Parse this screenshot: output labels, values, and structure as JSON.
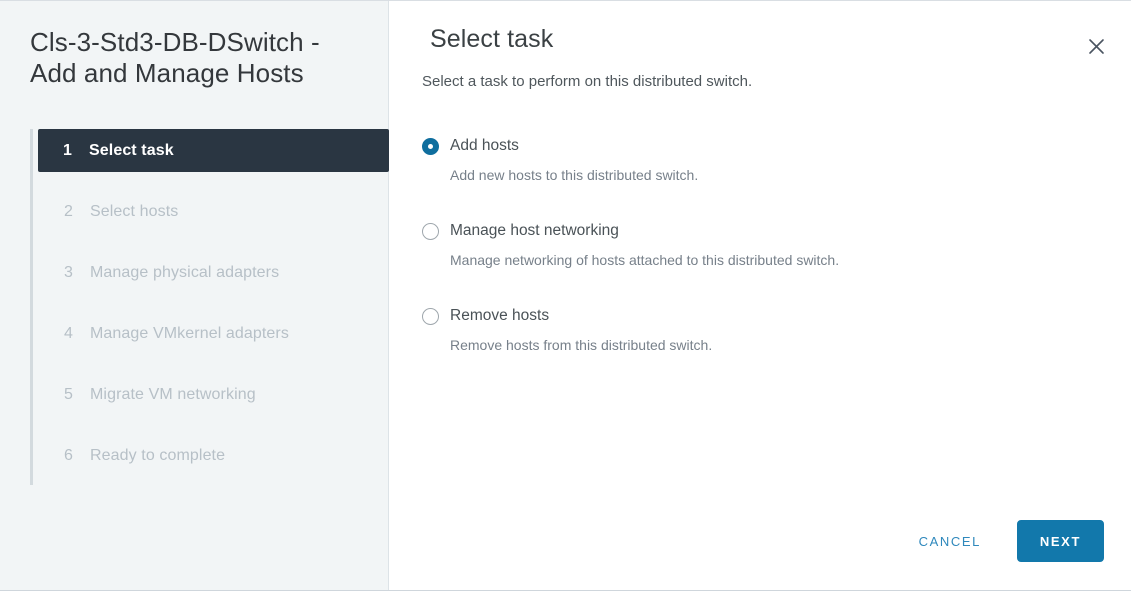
{
  "wizard": {
    "title": "Cls-3-Std3-DB-DSwitch - Add and Manage Hosts"
  },
  "sidebar": {
    "steps": [
      {
        "num": "1",
        "label": "Select task",
        "state": "active"
      },
      {
        "num": "2",
        "label": "Select hosts",
        "state": "inactive"
      },
      {
        "num": "3",
        "label": "Manage physical adapters",
        "state": "inactive"
      },
      {
        "num": "4",
        "label": "Manage VMkernel adapters",
        "state": "inactive"
      },
      {
        "num": "5",
        "label": "Migrate VM networking",
        "state": "inactive"
      },
      {
        "num": "6",
        "label": "Ready to complete",
        "state": "inactive"
      }
    ]
  },
  "panel": {
    "title": "Select task",
    "subtitle": "Select a task to perform on this distributed switch.",
    "close_icon": "close-icon",
    "options": [
      {
        "label": "Add hosts",
        "description": "Add new hosts to this distributed switch.",
        "selected": true
      },
      {
        "label": "Manage host networking",
        "description": "Manage networking of hosts attached to this distributed switch.",
        "selected": false
      },
      {
        "label": "Remove hosts",
        "description": "Remove hosts from this distributed switch.",
        "selected": false
      }
    ]
  },
  "footer": {
    "cancel_label": "CANCEL",
    "next_label": "NEXT"
  },
  "colors": {
    "accent": "#1278ab",
    "radio_selected": "#0f6e9e",
    "active_step_bg": "#2a3642",
    "sidebar_bg": "#f2f5f6",
    "link": "#2f88bc"
  }
}
